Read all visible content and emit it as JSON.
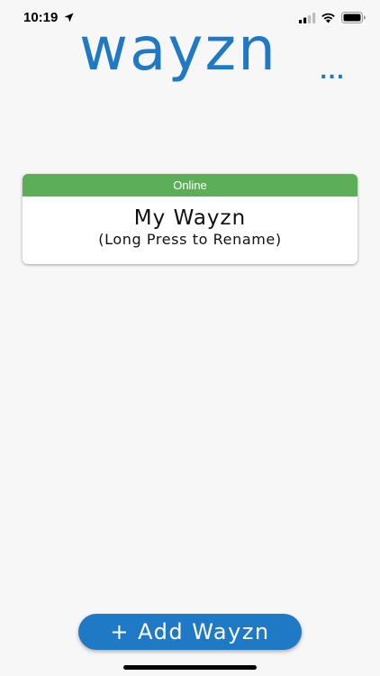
{
  "status_bar": {
    "time": "10:19",
    "icons": [
      "location-arrow-icon",
      "cellular-signal-icon",
      "wifi-icon",
      "battery-icon"
    ]
  },
  "header": {
    "logo_text": "wayzn",
    "logo_dots": "...",
    "brand_color": "#1f79c4"
  },
  "device_card": {
    "status": "Online",
    "status_color": "#5cae58",
    "name": "My Wayzn",
    "hint": "(Long Press to Rename)"
  },
  "actions": {
    "add_label": "+ Add Wayzn"
  }
}
